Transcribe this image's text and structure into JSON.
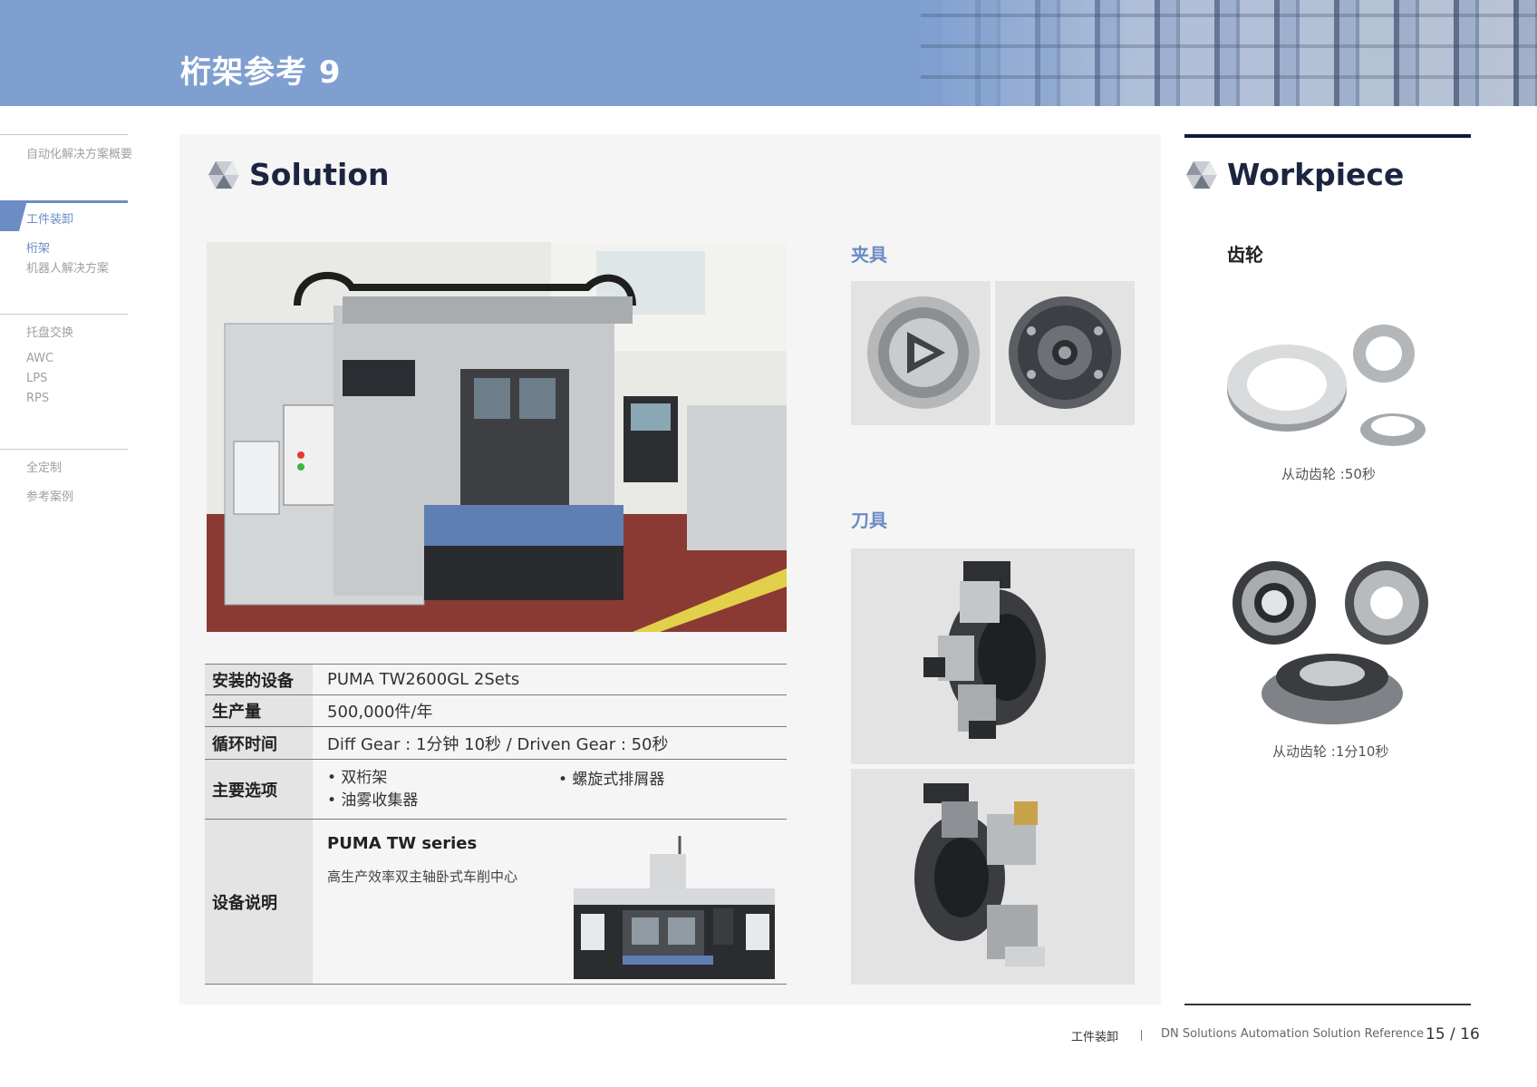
{
  "header": {
    "title": "桁架参考 9"
  },
  "sidebar": {
    "overview": "自动化解决方案概要",
    "group1_title": "工件装卸",
    "group1_items": [
      "桁架",
      "机器人解决方案"
    ],
    "group2_title": "托盘交换",
    "group2_items": [
      "AWC",
      "LPS",
      "RPS"
    ],
    "group3_items": [
      "全定制",
      "参考案例"
    ]
  },
  "solution": {
    "heading": "Solution",
    "specs": {
      "equipment_label": "安装的设备",
      "equipment_value": "PUMA TW2600GL 2Sets",
      "output_label": "生产量",
      "output_value": "500,000件/年",
      "cycle_label": "循环时间",
      "cycle_value": "Diff Gear : 1分钟 10秒  / Driven Gear : 50秒",
      "options_label": "主要选项",
      "options": [
        "• 双桁架",
        "• 油雾收集器",
        "• 螺旋式排屑器"
      ],
      "desc_label": "设备说明",
      "desc_title": "PUMA TW series",
      "desc_subtitle": "高生产效率双主轴卧式车削中心"
    },
    "fixture_heading": "夹具",
    "tool_heading": "刀具"
  },
  "workpiece": {
    "heading": "Workpiece",
    "gear_label": "齿轮",
    "caption1": "从动齿轮 :50秒",
    "caption2": "从动齿轮 :1分10秒"
  },
  "footer": {
    "section": "工件装卸",
    "doc": "DN Solutions Automation Solution Reference",
    "page": "15 / 16"
  },
  "colors": {
    "header_bg": "#7f9fd1",
    "accent": "#6b8cc4",
    "dark": "#1c2540"
  }
}
